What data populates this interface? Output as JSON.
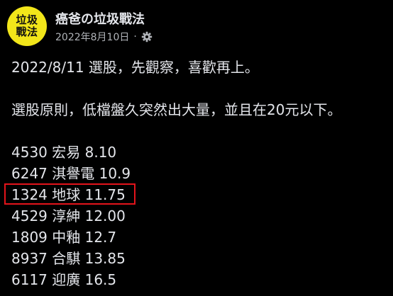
{
  "post": {
    "avatar_text": "垃圾戰法",
    "page_name": "癌爸の垃圾戰法",
    "date": "2022年8月10日",
    "dot": "·",
    "paragraph1": "2022/8/11 選股，先觀察，喜歡再上。",
    "paragraph2": "選股原則，低檔盤久突然出大量，並且在20元以下。",
    "stocks": [
      {
        "text": "4530 宏易 8.10"
      },
      {
        "text": "6247 淇譽電 10.9"
      },
      {
        "text": "1324 地球 11.75",
        "highlighted": true
      },
      {
        "text": "4529 淳紳 12.00"
      },
      {
        "text": "1809 中釉 12.7"
      },
      {
        "text": "8937 合騏 13.85"
      },
      {
        "text": "6117 迎廣 16.5"
      }
    ]
  },
  "colors": {
    "background": "#000000",
    "avatar": "#f2e61a",
    "text": "#e4e6eb",
    "meta": "#b0b3b8",
    "highlight": "#e3141b"
  },
  "icons": {
    "audience": "gear-icon"
  }
}
